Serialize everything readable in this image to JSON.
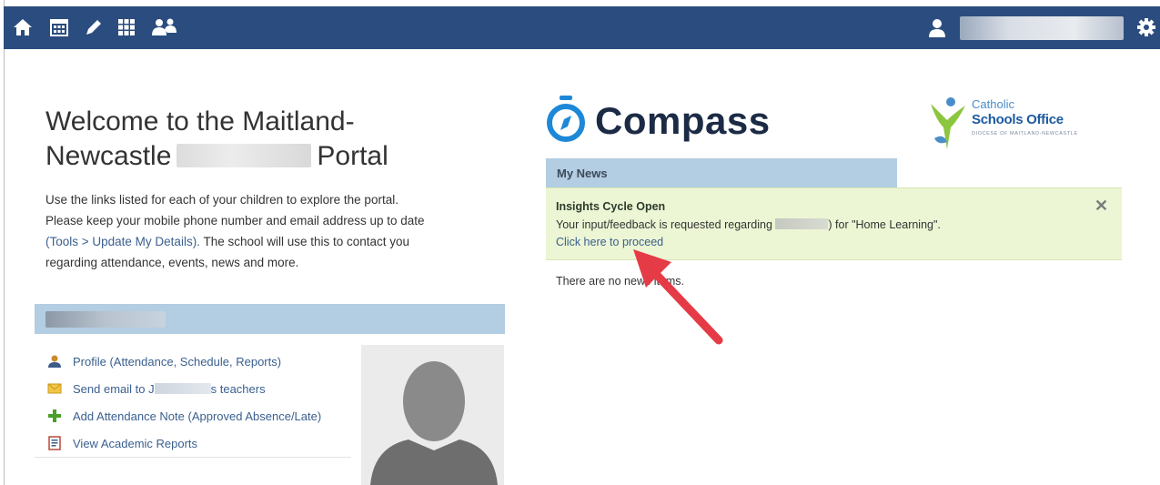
{
  "nav": {
    "icons": [
      "home-icon",
      "calendar-icon",
      "pencil-icon",
      "grid-icon",
      "people-icon"
    ],
    "user_icon": "user-icon",
    "settings_icon": "gear-icon",
    "user_name": ""
  },
  "colors": {
    "topbar": "#2b4c7e",
    "panel_header": "#b3cde2",
    "news_highlight": "#ecf6d4",
    "link": "#3a5f8f",
    "arrow": "#e53b46",
    "compass_logo_ring": "#1e88d8"
  },
  "welcome": {
    "title_line1": "Welcome to the Maitland-",
    "title_line2_start": "Newcastle",
    "title_line2_end": "Portal",
    "intro_line1": "Use the links listed for each of your children to explore the portal.",
    "intro_line2": "Please keep your mobile phone number and email address up to date",
    "intro_line3_link": "(Tools > Update My Details).",
    "intro_line3_rest": " The school will use this to contact you",
    "intro_line4": "regarding attendance, events, news and more."
  },
  "child": {
    "name": "",
    "links": [
      {
        "icon": "profile-icon",
        "label": "Profile (Attendance, Schedule, Reports)"
      },
      {
        "icon": "email-icon",
        "label_start": "Send email to J",
        "label_end": "s teachers"
      },
      {
        "icon": "plus-icon",
        "label": "Add Attendance Note (Approved Absence/Late)"
      },
      {
        "icon": "report-icon",
        "label": "View Academic Reports"
      }
    ]
  },
  "logos": {
    "compass_text": "Compass",
    "cso_line1": "Catholic",
    "cso_line2": "Schools Office",
    "cso_line3": "DIOCESE OF MAITLAND-NEWCASTLE"
  },
  "news": {
    "header": "My News",
    "item_title": "Insights Cycle Open",
    "item_body_start": "Your input/feedback is requested regarding",
    "item_body_end": ") for \"Home Learning\".",
    "item_link": "Click here to proceed",
    "close_label": "✕",
    "no_items": "There are no news items."
  }
}
